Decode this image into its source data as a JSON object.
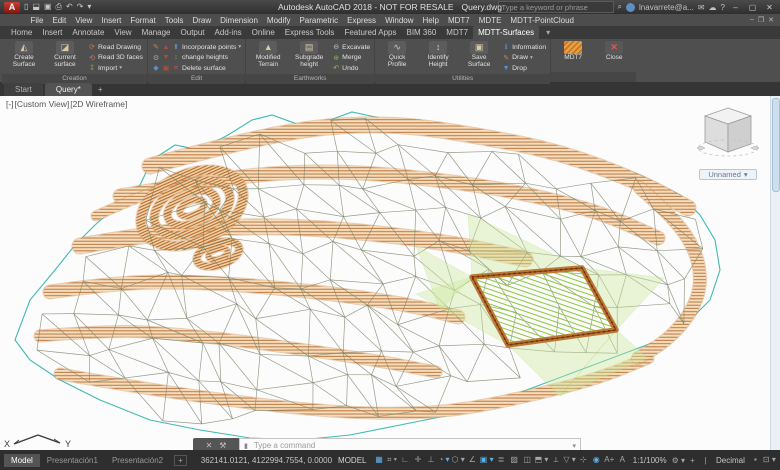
{
  "titlebar": {
    "logo": "A",
    "qat_icons": [
      {
        "name": "new-file-icon",
        "glyph": "▯"
      },
      {
        "name": "open-file-icon",
        "glyph": "⬓"
      },
      {
        "name": "save-icon",
        "glyph": "▣"
      },
      {
        "name": "plot-icon",
        "glyph": "⎙"
      },
      {
        "name": "undo-icon",
        "glyph": "↶"
      },
      {
        "name": "redo-icon",
        "glyph": "↷"
      },
      {
        "name": "qat-dropdown-icon",
        "glyph": "▾"
      }
    ],
    "app_title": "Autodesk AutoCAD 2018 - NOT FOR RESALE",
    "doc_title": "Query.dwg",
    "search_placeholder": "Type a keyword or phrase",
    "search_icon": "⌕",
    "user": "lnavarrete@a...",
    "help_icon": "?",
    "mail_icon": "✉",
    "cloud_icon": "☁",
    "window_controls": {
      "minimize": "–",
      "maximize": "▢",
      "close": "✕"
    }
  },
  "menubar": {
    "items": [
      "File",
      "Edit",
      "View",
      "Insert",
      "Format",
      "Tools",
      "Draw",
      "Dimension",
      "Modify",
      "Parametric",
      "Express",
      "Window",
      "Help",
      "MDT7",
      "MDTE",
      "MDTT-PointCloud"
    ],
    "doc_controls": {
      "minimize": "–",
      "restore": "❐",
      "close": "✕"
    }
  },
  "ribbon": {
    "tabs": [
      {
        "label": "Home"
      },
      {
        "label": "Insert"
      },
      {
        "label": "Annotate"
      },
      {
        "label": "View"
      },
      {
        "label": "Manage"
      },
      {
        "label": "Output"
      },
      {
        "label": "Add-ins"
      },
      {
        "label": "Online"
      },
      {
        "label": "Express Tools"
      },
      {
        "label": "Featured Apps"
      },
      {
        "label": "BIM 360"
      },
      {
        "label": "MDT7"
      },
      {
        "label": "MDTT-Surfaces",
        "active": true
      }
    ],
    "groups": [
      {
        "label": "Creation",
        "big": [
          {
            "label": "Create Surface",
            "icon": "◭"
          },
          {
            "label": "Current surface",
            "icon": "◪",
            "caret": true
          }
        ],
        "small": [
          {
            "label": "Read Drawing",
            "icon": "⟳"
          },
          {
            "label": "Read 3D faces",
            "icon": "⟲"
          },
          {
            "label": "Import",
            "icon": "↧",
            "caret": true
          }
        ]
      },
      {
        "label": "Edit",
        "rows": [
          {
            "label": "Incorporate points",
            "icons": [
              "✎",
              "▲",
              "⬆"
            ],
            "caret": true
          },
          {
            "label": "change heights",
            "icons": [
              "⚙",
              "▼",
              "↕"
            ]
          },
          {
            "label": "Delete surface",
            "icons": [
              "◆",
              "▣",
              "✕"
            ]
          }
        ]
      },
      {
        "label": "Earthworks",
        "big": [
          {
            "label": "Modified Terrain",
            "icon": "▲"
          },
          {
            "label": "Subgrade height",
            "icon": "▤",
            "caret": true
          }
        ],
        "small": [
          {
            "label": "Excavate",
            "icon": "⊖"
          },
          {
            "label": "Merge",
            "icon": "⊕"
          },
          {
            "label": "Undo",
            "icon": "↶"
          }
        ]
      },
      {
        "label": "Utilities",
        "big": [
          {
            "label": "Quick Profile",
            "icon": "∿"
          },
          {
            "label": "Identify Height",
            "icon": "↕"
          },
          {
            "label": "Save Surface",
            "icon": "▣",
            "caret": true
          }
        ],
        "small": [
          {
            "label": "Information",
            "icon": "ℹ"
          },
          {
            "label": "Draw",
            "icon": "✎",
            "caret": true
          },
          {
            "label": "Drop",
            "icon": "▼"
          }
        ]
      },
      {
        "label": "",
        "big": [
          {
            "label": "MDT7"
          },
          {
            "label": "Close"
          }
        ]
      }
    ],
    "overflow_caret": "▾"
  },
  "docbar": {
    "tabs": [
      {
        "label": "Start"
      },
      {
        "label": "Query*",
        "active": true
      }
    ],
    "add": "+"
  },
  "viewport": {
    "controls_label": "[-]",
    "view_label": "[Custom View]",
    "visual_style_label": "[2D Wireframe]",
    "viewcube_label": "Unnamed",
    "ucs_x": "X",
    "ucs_y": "Y"
  },
  "command": {
    "close_icon": "✕",
    "customize_icon": "⚒",
    "prompt_icon": "▮",
    "placeholder": "Type a command"
  },
  "statusbar": {
    "layout_tabs": [
      {
        "label": "Model",
        "active": true
      },
      {
        "label": "Presentación1"
      },
      {
        "label": "Presentación2"
      }
    ],
    "add_tab": "+",
    "coords": "362141.0121, 4122994.7554, 0.0000",
    "model_label": "MODEL",
    "scale": "1:1/100%",
    "units": "Decimal",
    "icons_a": [
      {
        "name": "grid-icon",
        "glyph": "▦",
        "state": "on"
      },
      {
        "name": "snap-mode-icon",
        "glyph": "⌗ ▾"
      },
      {
        "name": "infer-constraints-icon",
        "glyph": "∟"
      },
      {
        "name": "dynamic-input-icon",
        "glyph": "✛"
      },
      {
        "name": "ortho-mode-icon",
        "glyph": "⊥"
      },
      {
        "name": "polar-tracking-icon",
        "glyph": "◔ ▾",
        "state": "on"
      },
      {
        "name": "isometric-drafting-icon",
        "glyph": "⬡ ▾"
      },
      {
        "name": "object-snap-tracking-icon",
        "glyph": "∠"
      },
      {
        "name": "object-snap-icon",
        "glyph": "▣ ▾",
        "state": "on"
      },
      {
        "name": "lineweight-icon",
        "glyph": "≣"
      },
      {
        "name": "transparency-icon",
        "glyph": "▨"
      },
      {
        "name": "selection-cycling-icon",
        "glyph": "◫"
      },
      {
        "name": "3d-object-snap-icon",
        "glyph": "⬒ ▾"
      },
      {
        "name": "dynamic-ucs-icon",
        "glyph": "⟂"
      },
      {
        "name": "selection-filtering-icon",
        "glyph": "▽ ▾"
      },
      {
        "name": "gizmo-icon",
        "glyph": "⊹"
      },
      {
        "name": "annotation-visibility-icon",
        "glyph": "◉",
        "state": "on"
      },
      {
        "name": "annotation-autoscale-icon",
        "glyph": "A+"
      },
      {
        "name": "annotation-scale-letter-icon",
        "glyph": "A"
      }
    ],
    "icons_b": [
      {
        "name": "workspace-switching-icon",
        "glyph": "⚙ ▾"
      },
      {
        "name": "annotation-monitor-icon",
        "glyph": "+"
      },
      {
        "name": "units-divider-icon",
        "glyph": "|"
      }
    ],
    "icons_c": [
      {
        "name": "lock-ui-icon",
        "glyph": "▪"
      },
      {
        "name": "quick-properties-icon",
        "glyph": "⊡ ▾"
      },
      {
        "name": "isolate-objects-icon",
        "glyph": "⌖"
      },
      {
        "name": "graphics-performance-icon",
        "glyph": "▰",
        "state": "bg"
      },
      {
        "name": "isolate-highlight-icon",
        "glyph": "◧",
        "state": "warn"
      },
      {
        "name": "clean-screen-icon",
        "glyph": "⇲"
      },
      {
        "name": "customization-icon",
        "glyph": "≡"
      }
    ],
    "caret": "▾"
  },
  "colors": {
    "band_fill": "#f5debf",
    "band_line": "#c0763a",
    "band_fill_dark": "#eed2a8",
    "band_line_dark": "#b2601f",
    "band_under": "#cf9255",
    "mesh_line": "#798266",
    "boundary": "#2ab3ac",
    "pad_border": "#b87a34",
    "pad_border_dark": "#6e4312",
    "pad_hatch": "#8cc63e",
    "pad_fan": "#cdea9e",
    "pad_dash": "#8b1d12",
    "canvas_bg": "#fcfcfc"
  }
}
